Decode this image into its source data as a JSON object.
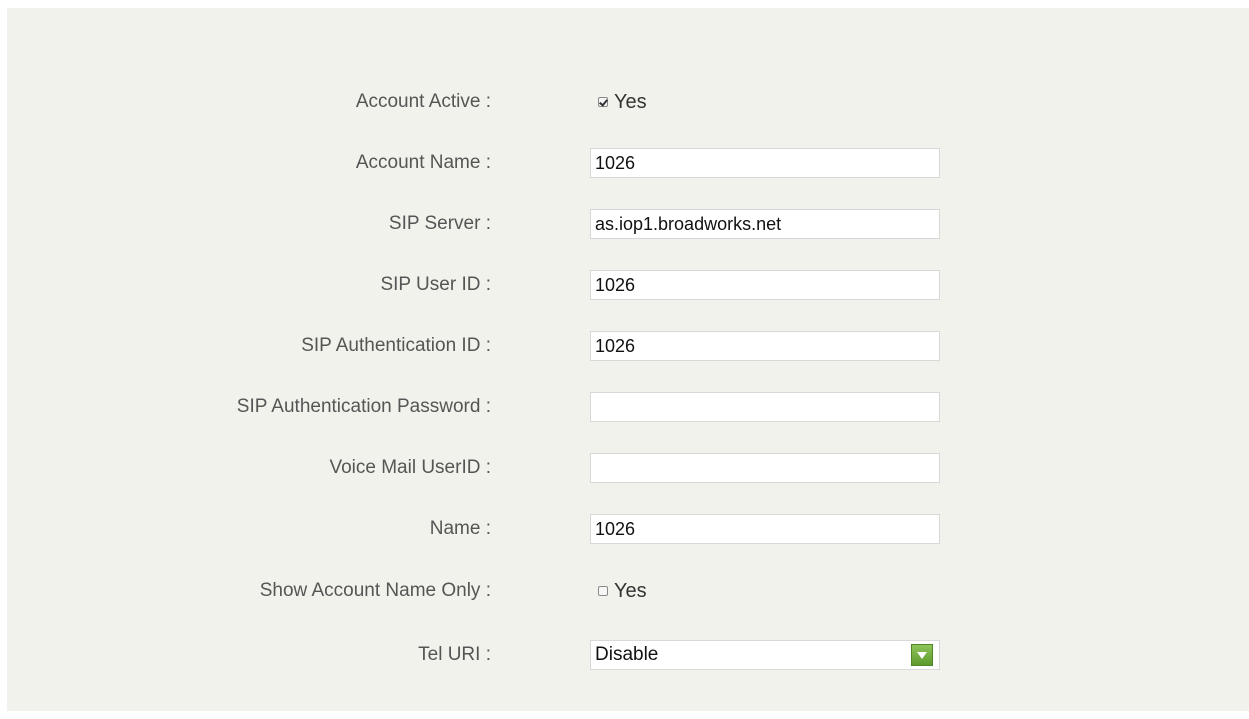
{
  "form": {
    "account_active": {
      "label": "Account Active :",
      "checked": true,
      "option": "Yes"
    },
    "account_name": {
      "label": "Account Name :",
      "value": "1026"
    },
    "sip_server": {
      "label": "SIP Server :",
      "value": "as.iop1.broadworks.net"
    },
    "sip_user_id": {
      "label": "SIP User ID :",
      "value": "1026"
    },
    "sip_auth_id": {
      "label": "SIP Authentication ID :",
      "value": "1026"
    },
    "sip_auth_password": {
      "label": "SIP Authentication Password :",
      "value": ""
    },
    "voice_mail_userid": {
      "label": "Voice Mail UserID :",
      "value": ""
    },
    "name": {
      "label": "Name :",
      "value": "1026"
    },
    "show_account_name_only": {
      "label": "Show Account Name Only :",
      "checked": false,
      "option": "Yes"
    },
    "tel_uri": {
      "label": "Tel URI :",
      "value": "Disable"
    }
  },
  "colors": {
    "panel_bg": "#f2f2ec",
    "label_text": "#555555",
    "dropdown_accent": "#6aa83a"
  }
}
